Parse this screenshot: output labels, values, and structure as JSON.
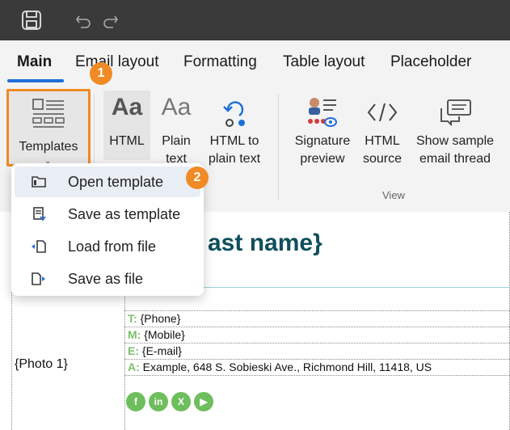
{
  "tabs": [
    {
      "label": "Main"
    },
    {
      "label": "Email layout"
    },
    {
      "label": "Formatting"
    },
    {
      "label": "Table layout"
    },
    {
      "label": "Placeholder"
    }
  ],
  "ribbon": {
    "templates_label": "Templates",
    "html_label": "HTML",
    "html_icon_text": "Aa",
    "plain_text_label_1": "Plain",
    "plain_text_label_2": "text",
    "plain_icon_text": "Aa",
    "html_to_plain_1": "HTML to",
    "html_to_plain_2": "plain text",
    "signature_preview_1": "Signature",
    "signature_preview_2": "preview",
    "html_source_1": "HTML",
    "html_source_2": "source",
    "sample_thread_1": "Show sample",
    "sample_thread_2": "email thread",
    "group_view": "View"
  },
  "menu": {
    "items": [
      {
        "label": "Open template",
        "icon": "folder-icon"
      },
      {
        "label": "Save as template",
        "icon": "save-template-icon"
      },
      {
        "label": "Load from file",
        "icon": "load-file-icon"
      },
      {
        "label": "Save as file",
        "icon": "save-file-icon"
      }
    ]
  },
  "badges": {
    "one": "1",
    "two": "2"
  },
  "signature": {
    "name_fragment": "ast name}",
    "photo": "{Photo 1}",
    "phone_key": "T:",
    "phone_val": "{Phone}",
    "mobile_key": "M:",
    "mobile_val": "{Mobile}",
    "email_key": "E:",
    "email_val": "{E-mail}",
    "address_key": "A:",
    "address_val": "Example, 648 S. Sobieski Ave., Richmond Hill, 11418, US"
  },
  "social": [
    "f",
    "in",
    "X",
    "▶"
  ],
  "colors": {
    "accent": "#1e6fd9",
    "badge": "#f08a24",
    "sig_green": "#7cbf6d",
    "name_teal": "#0e4f5c"
  }
}
